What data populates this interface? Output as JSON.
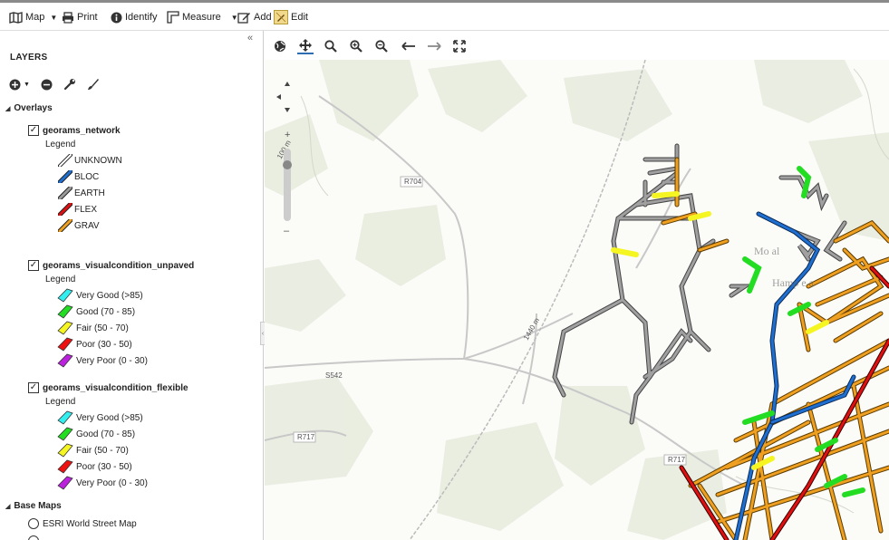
{
  "toolbar": {
    "map": "Map",
    "print": "Print",
    "identify": "Identify",
    "measure": "Measure",
    "add": "Add",
    "edit": "Edit"
  },
  "sidebar": {
    "title": "LAYERS",
    "overlays_label": "Overlays",
    "legend_label": "Legend",
    "basemaps_label": "Base Maps",
    "layers": [
      {
        "name": "georams_network",
        "checked": true,
        "legend": [
          {
            "label": "UNKNOWN",
            "color": "#ffffff"
          },
          {
            "label": "BLOC",
            "color": "#1f6fd1"
          },
          {
            "label": "EARTH",
            "color": "#9a9a9a"
          },
          {
            "label": "FLEX",
            "color": "#e01010"
          },
          {
            "label": "GRAV",
            "color": "#f0a020"
          }
        ]
      },
      {
        "name": "georams_visualcondition_unpaved",
        "checked": true,
        "legend": [
          {
            "label": "Very Good (>85)",
            "color": "#33eeee"
          },
          {
            "label": "Good (70 - 85)",
            "color": "#22dd22"
          },
          {
            "label": "Fair (50 - 70)",
            "color": "#f5f522"
          },
          {
            "label": "Poor (30 - 50)",
            "color": "#ee1111"
          },
          {
            "label": "Very Poor (0 - 30)",
            "color": "#bb22dd"
          }
        ]
      },
      {
        "name": "georams_visualcondition_flexible",
        "checked": true,
        "legend": [
          {
            "label": "Very Good (>85)",
            "color": "#33eeee"
          },
          {
            "label": "Good (70 - 85)",
            "color": "#22dd22"
          },
          {
            "label": "Fair (50 - 70)",
            "color": "#f5f522"
          },
          {
            "label": "Poor (30 - 50)",
            "color": "#ee1111"
          },
          {
            "label": "Very Poor (0 - 30)",
            "color": "#bb22dd"
          }
        ]
      }
    ],
    "basemaps": [
      {
        "label": "ESRI World Street Map",
        "selected": false
      }
    ]
  },
  "map": {
    "road_labels": [
      "R704",
      "S542",
      "R717",
      "R717",
      "1440 m"
    ],
    "scale_label": "100 m"
  }
}
